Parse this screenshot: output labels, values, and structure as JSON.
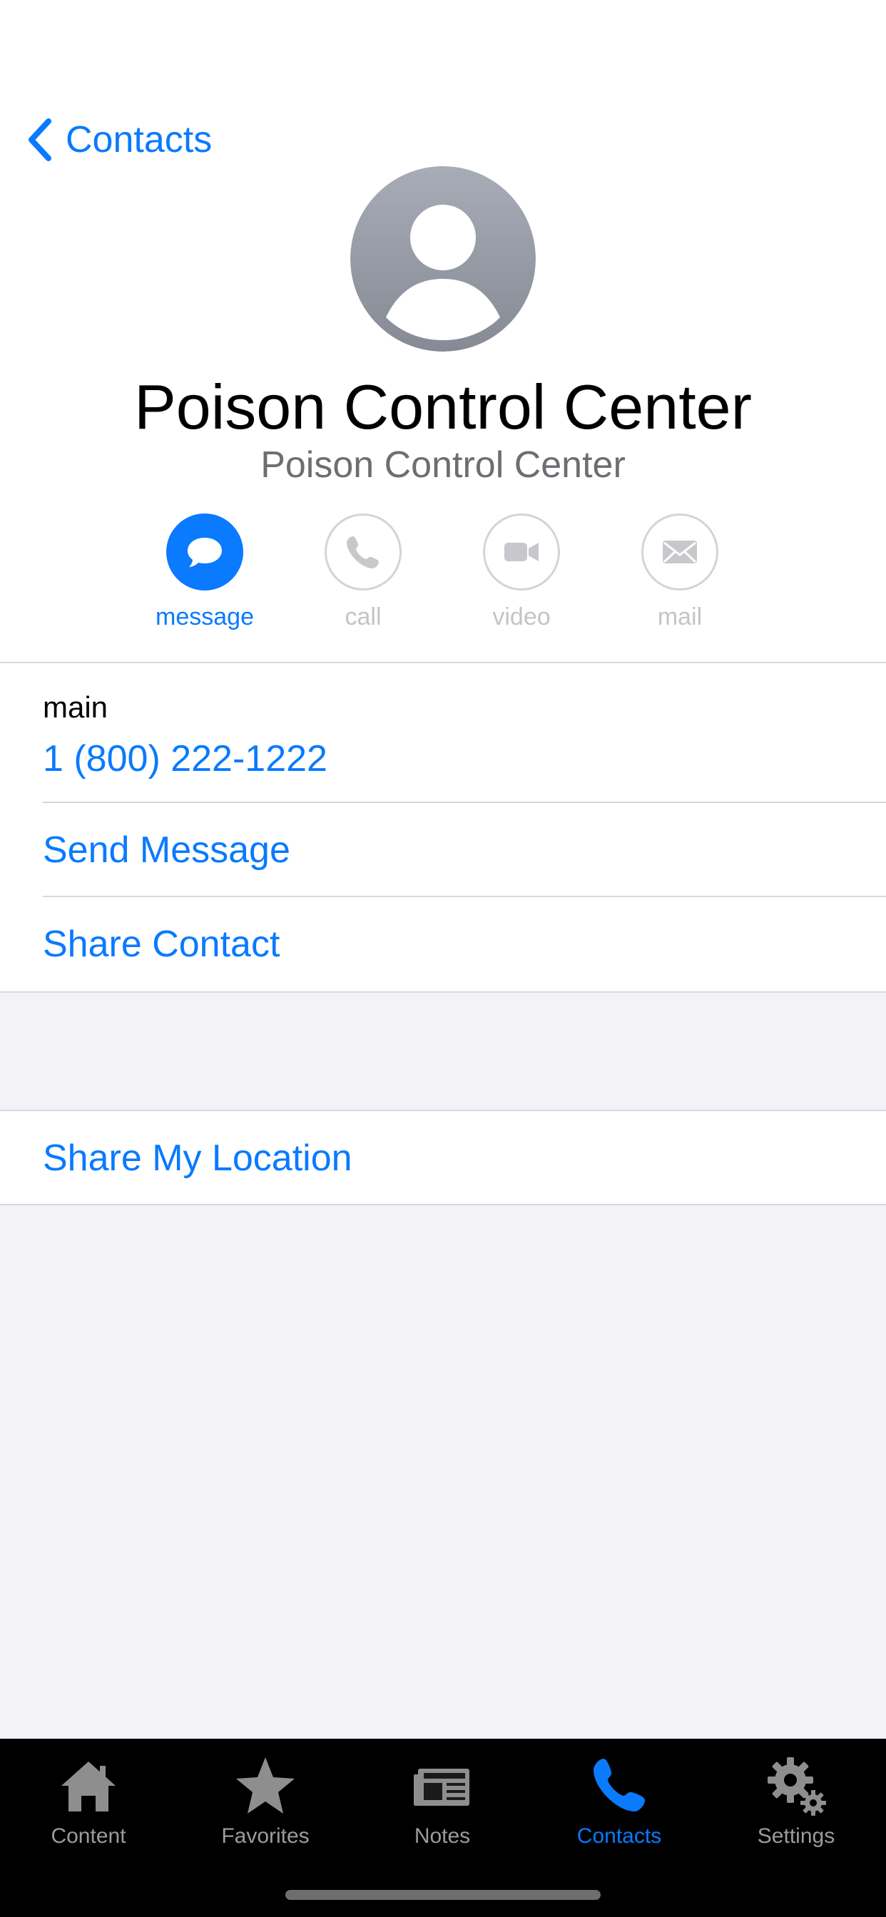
{
  "nav": {
    "back_label": "Contacts"
  },
  "contact": {
    "name": "Poison Control Center",
    "subtitle": "Poison Control Center"
  },
  "actions": [
    {
      "label": "message",
      "icon": "message-bubble-icon",
      "enabled": true
    },
    {
      "label": "call",
      "icon": "phone-icon",
      "enabled": false
    },
    {
      "label": "video",
      "icon": "video-camera-icon",
      "enabled": false
    },
    {
      "label": "mail",
      "icon": "envelope-icon",
      "enabled": false
    }
  ],
  "phone": {
    "label": "main",
    "number": "1 (800) 222-1222"
  },
  "links": {
    "send_message": "Send Message",
    "share_contact": "Share Contact",
    "share_location": "Share My Location"
  },
  "tabbar": {
    "items": [
      {
        "label": "Content",
        "icon": "house-icon",
        "active": false
      },
      {
        "label": "Favorites",
        "icon": "star-icon",
        "active": false
      },
      {
        "label": "Notes",
        "icon": "newspaper-icon",
        "active": false
      },
      {
        "label": "Contacts",
        "icon": "phone-icon",
        "active": true
      },
      {
        "label": "Settings",
        "icon": "gear-icon",
        "active": false
      }
    ]
  },
  "colors": {
    "accent": "#0a7aff",
    "background": "#f2f2f7",
    "tabbar": "#000000",
    "inactive_tab": "#9b9b9b"
  }
}
